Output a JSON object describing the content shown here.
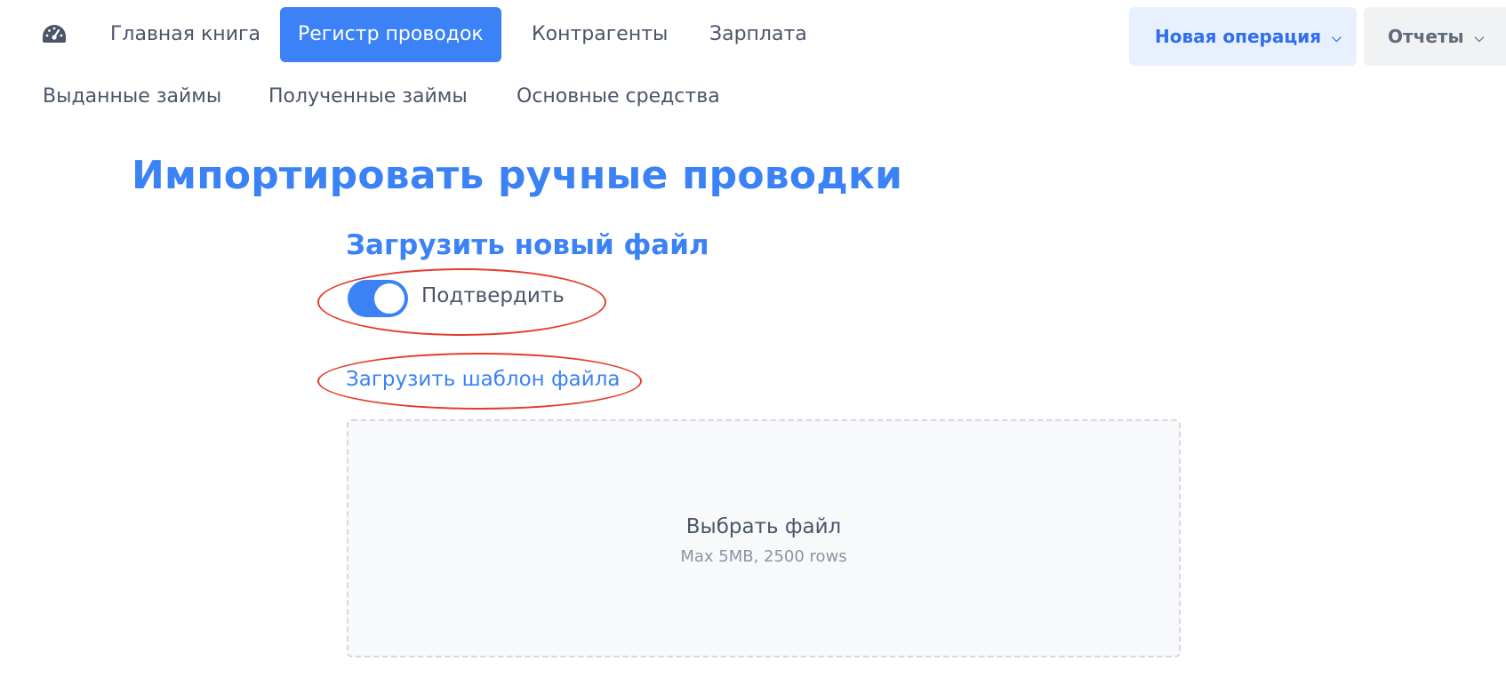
{
  "nav": {
    "dashboard_icon": "speedometer-icon",
    "primary": [
      {
        "label": "Главная книга"
      },
      {
        "label": "Регистр проводок",
        "active": true
      },
      {
        "label": "Контрагенты"
      },
      {
        "label": "Зарплата"
      }
    ],
    "secondary": [
      {
        "label": "Выданные займы"
      },
      {
        "label": "Полученные займы"
      },
      {
        "label": "Основные средства"
      }
    ],
    "new_operation_label": "Новая операция",
    "reports_label": "Отчеты"
  },
  "page": {
    "title": "Импортировать ручные проводки",
    "section_title": "Загрузить новый файл",
    "confirm_toggle": {
      "label": "Подтвердить",
      "on": true
    },
    "template_link": "Загрузить шаблон файла",
    "dropzone": {
      "title": "Выбрать файл",
      "subtitle": "Max 5MB, 2500 rows"
    }
  },
  "colors": {
    "accent": "#3b82f6",
    "annotation": "#e53b2c"
  }
}
